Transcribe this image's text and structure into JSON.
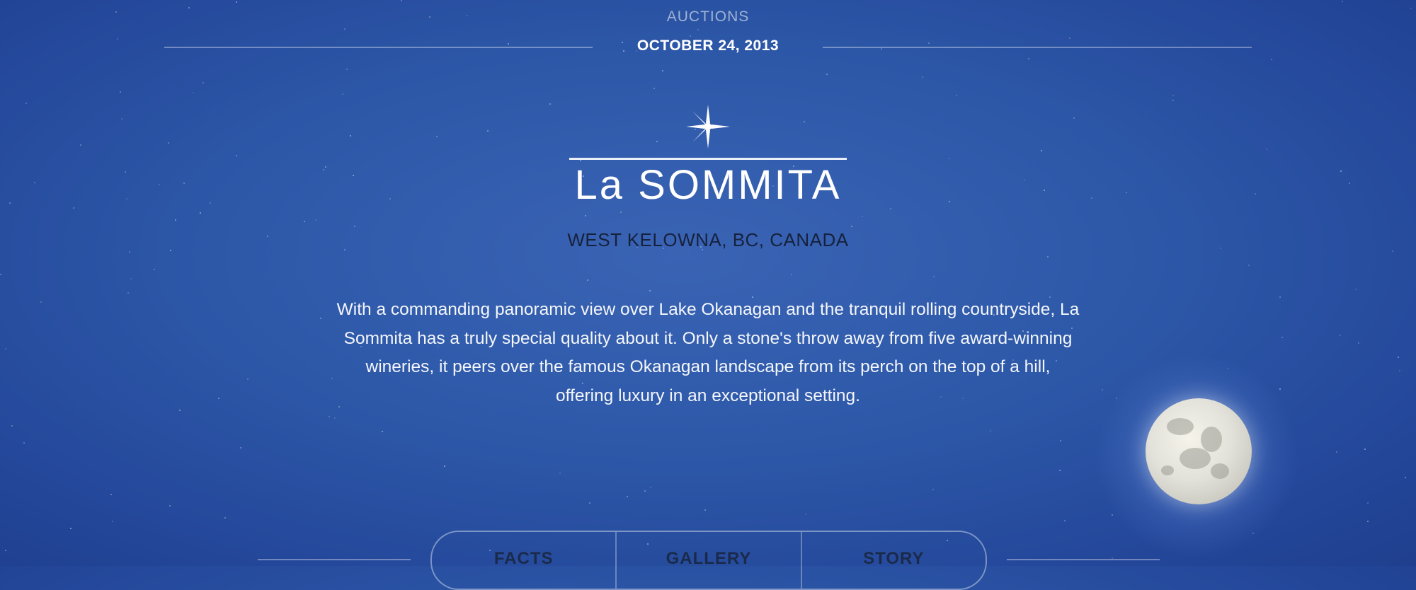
{
  "header": {
    "section_label": "AUCTIONS",
    "date": "OCTOBER 24, 2013"
  },
  "property": {
    "logo_text": "La SOMMITA",
    "location": "WEST KELOWNA, BC, CANADA",
    "description_lines": [
      "With a commanding panoramic view over Lake Okanagan and the tranquil rolling countryside, La",
      "Sommita has a truly special quality about it. Only a stone's throw away from five award-winning",
      "wineries, it peers over the famous Okanagan landscape from its perch on the top of a hill,",
      "offering luxury in an exceptional setting."
    ]
  },
  "nav": {
    "items": [
      {
        "label": "FACTS"
      },
      {
        "label": "GALLERY"
      },
      {
        "label": "STORY"
      }
    ]
  },
  "colors": {
    "background": "#2d58a8",
    "text_light": "#ffffff",
    "text_dark": "#16223d"
  },
  "icons": {
    "logo_mark": "star-burst-icon",
    "moon": "moon-illustration"
  }
}
